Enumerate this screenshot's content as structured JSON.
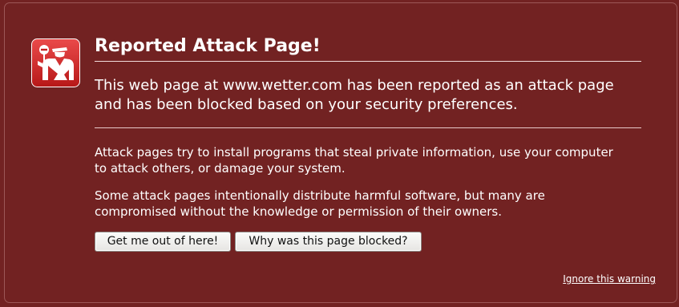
{
  "page": {
    "title": "Reported Attack Page!",
    "lead": "This web page at www.wetter.com has been reported as an attack page and has been blocked based on your security preferences.",
    "paragraphs": [
      "Attack pages try to install programs that steal private information, use your computer to attack others, or damage your system.",
      "Some attack pages intentionally distribute harmful software, but many are compromised without the knowledge or permission of their owners."
    ]
  },
  "buttons": {
    "escape_label": "Get me out of here!",
    "why_label": "Why was this page blocked?"
  },
  "links": {
    "ignore_label": "Ignore this warning"
  },
  "icons": {
    "badge": "police-officer-stop-icon"
  },
  "colors": {
    "background": "#722222",
    "icon_red": "#d42323",
    "text": "#ffffff"
  }
}
